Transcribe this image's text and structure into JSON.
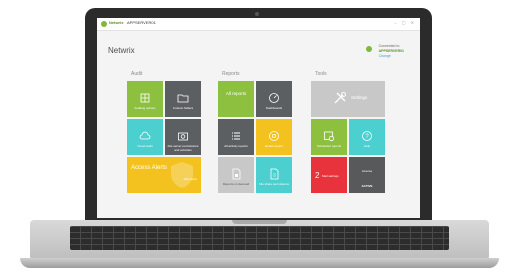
{
  "app": {
    "brand": "Netwrix",
    "server": "APPSERVER01",
    "window_controls": "– ▢ ✕"
  },
  "page": {
    "title": "Netwrix"
  },
  "connection": {
    "status": "Connected to",
    "server": "APPSERVER01",
    "action": "Change"
  },
  "sections": {
    "audit": "Audit",
    "reports": "Reports",
    "tools": "Tools"
  },
  "tiles": {
    "auditing_options": "Auditing options",
    "custom_folders": "Custom folders",
    "cloud_audit": "Cloud audit",
    "file_activity": "File server permissions and activities",
    "access_alerts": "Access Alerts",
    "access_alerts_sub": "Add alerts",
    "all_reports": "All reports",
    "dashboards": "Dashboards",
    "all_activity_reports": "All activity reports",
    "email_reports": "Email reports",
    "reports_on_demand": "Reports on demand",
    "file_share_permissions": "File share permissions",
    "settings": "Settings",
    "scheduled_reports": "Scheduled reports",
    "help": "Help",
    "mail_settings": "Mail settings",
    "license": "License",
    "license_status": "ACTIVE"
  },
  "colors": {
    "green": "#8dc03f",
    "dark": "#5c5f62",
    "teal": "#4ccfcf",
    "yellow": "#f4c21f",
    "grey_light": "#c8c8c8",
    "red": "#e8323c",
    "grey_dark": "#58595b"
  }
}
